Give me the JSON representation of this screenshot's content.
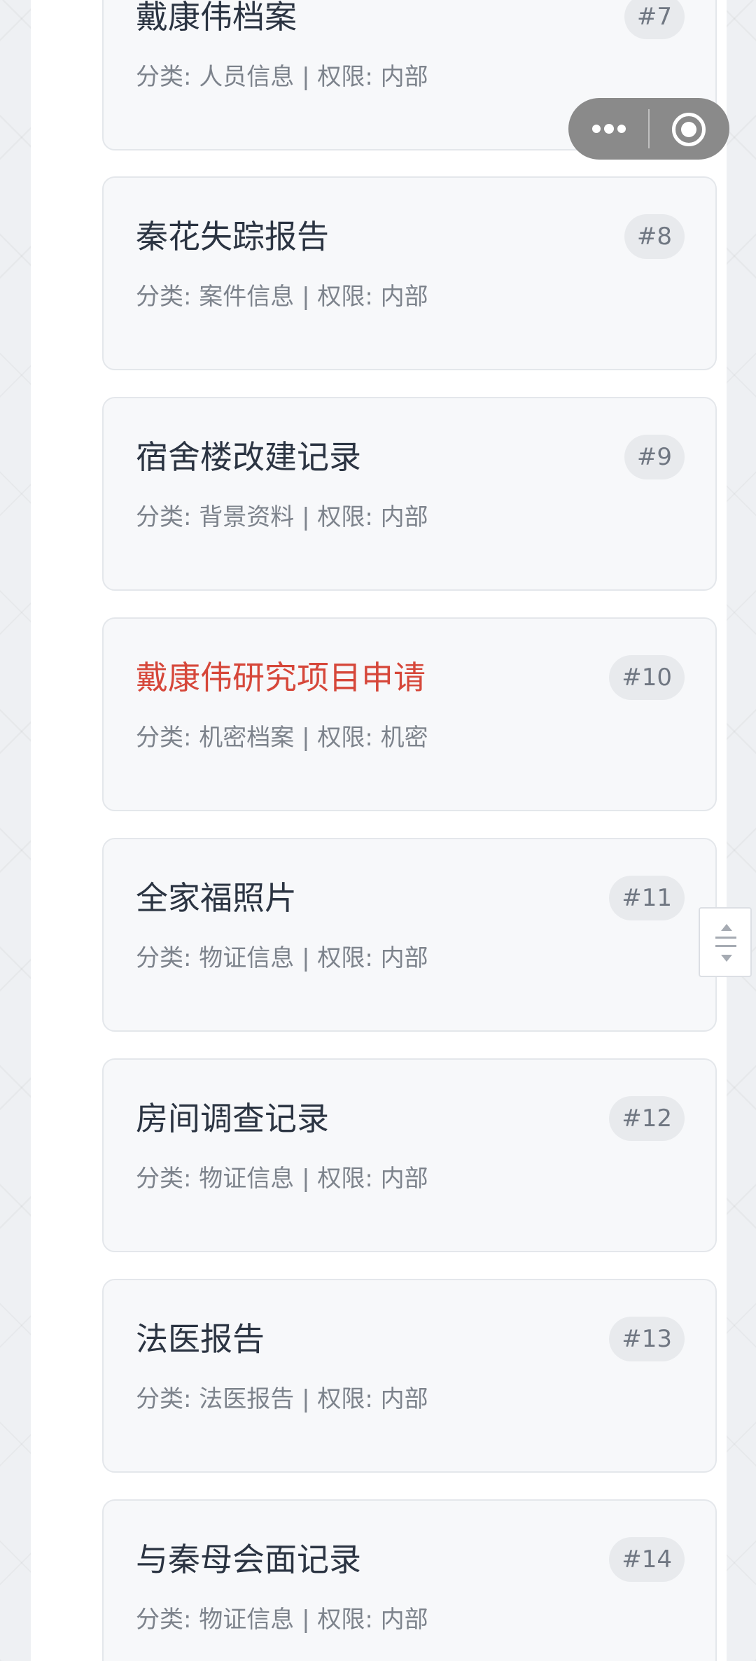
{
  "documents": [
    {
      "title": "戴康伟档案",
      "badge": "#7",
      "meta": "分类: 人员信息 | 权限: 内部",
      "confidential": false
    },
    {
      "title": "秦花失踪报告",
      "badge": "#8",
      "meta": "分类: 案件信息 | 权限: 内部",
      "confidential": false
    },
    {
      "title": "宿舍楼改建记录",
      "badge": "#9",
      "meta": "分类: 背景资料 | 权限: 内部",
      "confidential": false
    },
    {
      "title": "戴康伟研究项目申请",
      "badge": "#10",
      "meta": "分类: 机密档案 | 权限: 机密",
      "confidential": true
    },
    {
      "title": "全家福照片",
      "badge": "#11",
      "meta": "分类: 物证信息 | 权限: 内部",
      "confidential": false
    },
    {
      "title": "房间调查记录",
      "badge": "#12",
      "meta": "分类: 物证信息 | 权限: 内部",
      "confidential": false
    },
    {
      "title": "法医报告",
      "badge": "#13",
      "meta": "分类: 法医报告 | 权限: 内部",
      "confidential": false
    },
    {
      "title": "与秦母会面记录",
      "badge": "#14",
      "meta": "分类: 物证信息 | 权限: 内部",
      "confidential": false
    }
  ],
  "colors": {
    "title": "#2b3442",
    "confidential_title": "#d6473a",
    "meta": "#7d838c",
    "badge_bg": "#e8eaed"
  },
  "icons": {
    "capsule_more": "more-dots-icon",
    "capsule_close": "target-circle-icon",
    "side_handle": "drag-handle-icon"
  }
}
